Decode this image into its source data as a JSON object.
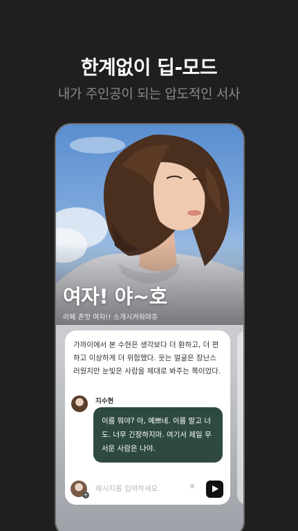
{
  "promo": {
    "headline": "한계없이 딥-모드",
    "subheadline": "내가 주인공이 되는 압도적인 서사"
  },
  "character": {
    "title": "여자! 야~호",
    "description": "라페 존멋 여자!! 소개시켜줘야쥬"
  },
  "chat": {
    "narration": "가까이에서 본 수현은 생각보다 더 환하고, 더 편하고 이상하게 더 위험했다. 웃는 얼굴은 장난스러웠지만 눈빛은 사람을 제대로 봐주는 쪽이었다.",
    "speaker": "지수현",
    "message": "이름 뭐야? 아, 예쁘네. 이름 말고 너도. 너무 긴장하지마. 여기서 제일 무서운 사람은 나야."
  },
  "input": {
    "placeholder": "메시지를 입력하세요."
  },
  "colors": {
    "background": "#1f1f1f",
    "bubble": "#2e4a3e",
    "subheadline": "#8a8a8a"
  },
  "icons": [
    "asterisk-icon",
    "send-icon",
    "plus-icon"
  ]
}
